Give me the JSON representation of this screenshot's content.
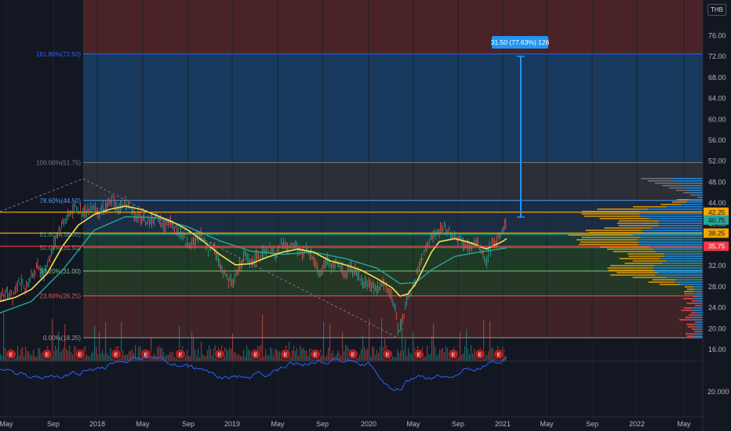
{
  "currency": "THB",
  "chart_data": {
    "type": "candlestick",
    "x_ticks": [
      "May",
      "Sep",
      "2018",
      "May",
      "Sep",
      "2019",
      "May",
      "Sep",
      "2020",
      "May",
      "Sep",
      "2021",
      "May",
      "Sep",
      "2022",
      "May"
    ],
    "y_ticks": [
      16,
      20,
      24,
      28,
      32,
      36,
      40,
      44,
      48,
      52,
      56,
      60,
      64,
      68,
      72,
      76
    ],
    "y_tick_labels": [
      "16.00",
      "20.00",
      "24.00",
      "28.00",
      "32.00",
      "36.00",
      "40.00",
      "44.00",
      "48.00",
      "52.00",
      "56.00",
      "60.00",
      "64.00",
      "68.00",
      "72.00",
      "76.00"
    ],
    "ylim": [
      14.5,
      79
    ],
    "fib_levels": [
      {
        "label": "161.80%(72.50)",
        "value": 72.5,
        "color": "#2962ff"
      },
      {
        "label": "100.00%(51.75)",
        "value": 51.75,
        "color": "#787b86"
      },
      {
        "label": "78.60%(44.50)",
        "value": 44.5,
        "color": "#4f9cf2"
      },
      {
        "label": "61.80%(38.00)",
        "value": 38.0,
        "color": "#26a69a"
      },
      {
        "label": "50.00%(35.50)",
        "value": 35.5,
        "color": "#4caf50"
      },
      {
        "label": "38.20%(31.00)",
        "value": 31.0,
        "color": "#81c784"
      },
      {
        "label": "23.60%(26.25)",
        "value": 26.25,
        "color": "#ef5350"
      },
      {
        "label": "0.00%(18.25)",
        "value": 18.25,
        "color": "#9e9e9e"
      }
    ],
    "price_tags": [
      {
        "label": "42.25",
        "value": 42.25,
        "color": "#f7a600",
        "text_color": "#131722"
      },
      {
        "label": "40.75",
        "value": 40.75,
        "color": "#26a69a",
        "text_color": "#131722"
      },
      {
        "label": "38.25",
        "value": 38.25,
        "color": "#f7a600",
        "text_color": "#131722"
      },
      {
        "label": "35.75",
        "value": 35.75,
        "color": "#f23645",
        "text_color": "#ffffff"
      }
    ],
    "horizontal_lines": [
      {
        "value": 42.25,
        "color": "#f7a600"
      },
      {
        "value": 38.25,
        "color": "#f7a600"
      },
      {
        "value": 35.75,
        "color": "#f23645"
      }
    ],
    "measure_label": "31.50 (77.63%) 126",
    "close_series": [
      [
        0,
        25.5
      ],
      [
        8,
        26.8
      ],
      [
        16,
        26.2
      ],
      [
        24,
        29.5
      ],
      [
        32,
        27.2
      ],
      [
        40,
        30.2
      ],
      [
        48,
        32.0
      ],
      [
        56,
        30.5
      ],
      [
        64,
        34.0
      ],
      [
        72,
        37.5
      ],
      [
        80,
        40.5
      ],
      [
        88,
        41.8
      ],
      [
        96,
        43.2
      ],
      [
        104,
        42.0
      ],
      [
        112,
        42.8
      ],
      [
        120,
        43.6
      ],
      [
        128,
        42.3
      ],
      [
        136,
        43.5
      ],
      [
        144,
        44.8
      ],
      [
        152,
        42.6
      ],
      [
        160,
        44.2
      ],
      [
        168,
        42.7
      ],
      [
        176,
        41.5
      ],
      [
        184,
        40.6
      ],
      [
        192,
        40.2
      ],
      [
        200,
        41.3
      ],
      [
        208,
        39.8
      ],
      [
        216,
        40.3
      ],
      [
        224,
        39.2
      ],
      [
        232,
        37.6
      ],
      [
        240,
        36.0
      ],
      [
        248,
        36.6
      ],
      [
        256,
        38.2
      ],
      [
        264,
        35.2
      ],
      [
        272,
        35.8
      ],
      [
        280,
        32.6
      ],
      [
        288,
        30.2
      ],
      [
        296,
        28.8
      ],
      [
        304,
        31.2
      ],
      [
        312,
        34.0
      ],
      [
        320,
        32.8
      ],
      [
        328,
        33.6
      ],
      [
        336,
        34.4
      ],
      [
        344,
        35.2
      ],
      [
        352,
        34.2
      ],
      [
        360,
        36.4
      ],
      [
        368,
        35.0
      ],
      [
        376,
        35.8
      ],
      [
        384,
        34.2
      ],
      [
        392,
        35.0
      ],
      [
        400,
        33.2
      ],
      [
        408,
        30.4
      ],
      [
        416,
        33.0
      ],
      [
        424,
        31.8
      ],
      [
        432,
        32.6
      ],
      [
        440,
        30.2
      ],
      [
        448,
        31.8
      ],
      [
        456,
        30.4
      ],
      [
        464,
        28.8
      ],
      [
        472,
        28.2
      ],
      [
        480,
        27.6
      ],
      [
        488,
        28.6
      ],
      [
        496,
        26.8
      ],
      [
        502,
        25.2
      ],
      [
        508,
        19.5
      ],
      [
        514,
        22.4
      ],
      [
        520,
        25.8
      ],
      [
        528,
        28.2
      ],
      [
        536,
        32.8
      ],
      [
        544,
        35.6
      ],
      [
        552,
        37.6
      ],
      [
        560,
        38.6
      ],
      [
        568,
        39.6
      ],
      [
        576,
        38.2
      ],
      [
        584,
        37.0
      ],
      [
        592,
        36.2
      ],
      [
        600,
        35.2
      ],
      [
        608,
        36.8
      ],
      [
        616,
        34.2
      ],
      [
        620,
        32.2
      ],
      [
        624,
        35.2
      ],
      [
        632,
        36.4
      ],
      [
        640,
        38.6
      ],
      [
        646,
        40.4
      ]
    ],
    "ma_fast": [
      [
        0,
        25.2
      ],
      [
        20,
        26.0
      ],
      [
        40,
        27.5
      ],
      [
        60,
        30.5
      ],
      [
        80,
        35.8
      ],
      [
        100,
        39.8
      ],
      [
        120,
        41.8
      ],
      [
        140,
        42.8
      ],
      [
        160,
        43.4
      ],
      [
        180,
        42.8
      ],
      [
        200,
        41.6
      ],
      [
        220,
        40.4
      ],
      [
        240,
        38.8
      ],
      [
        260,
        36.6
      ],
      [
        280,
        34.2
      ],
      [
        300,
        32.2
      ],
      [
        320,
        32.4
      ],
      [
        340,
        33.6
      ],
      [
        360,
        34.6
      ],
      [
        380,
        35.2
      ],
      [
        400,
        34.6
      ],
      [
        420,
        33.0
      ],
      [
        440,
        32.2
      ],
      [
        460,
        31.2
      ],
      [
        480,
        29.6
      ],
      [
        500,
        27.8
      ],
      [
        510,
        26.2
      ],
      [
        520,
        26.6
      ],
      [
        530,
        28.6
      ],
      [
        540,
        31.6
      ],
      [
        550,
        34.6
      ],
      [
        560,
        36.6
      ],
      [
        580,
        37.2
      ],
      [
        600,
        36.4
      ],
      [
        620,
        35.2
      ],
      [
        640,
        36.6
      ],
      [
        646,
        37.2
      ]
    ],
    "ma_slow": [
      [
        0,
        23.0
      ],
      [
        40,
        25.2
      ],
      [
        80,
        31.2
      ],
      [
        120,
        38.8
      ],
      [
        160,
        41.4
      ],
      [
        200,
        41.2
      ],
      [
        240,
        39.4
      ],
      [
        280,
        36.8
      ],
      [
        320,
        34.8
      ],
      [
        360,
        34.2
      ],
      [
        400,
        34.6
      ],
      [
        440,
        33.4
      ],
      [
        480,
        31.6
      ],
      [
        510,
        28.6
      ],
      [
        530,
        28.8
      ],
      [
        550,
        31.2
      ],
      [
        580,
        33.8
      ],
      [
        610,
        34.6
      ],
      [
        646,
        35.4
      ]
    ]
  }
}
